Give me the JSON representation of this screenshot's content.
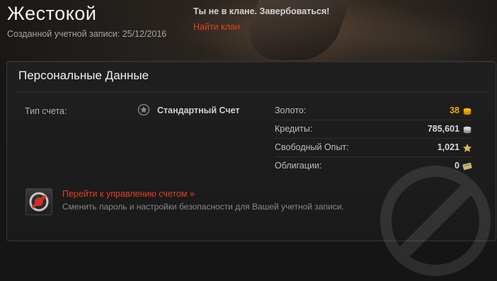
{
  "header": {
    "player_name": "Жестокой",
    "created_label": "Созданной учетной записи: 25/12/2016",
    "clan_status": "Ты не в клане. Завербоваться!",
    "find_clan": "Найти клан"
  },
  "panel": {
    "title": "Персональные Данные",
    "account_type_label": "Тип счета:",
    "account_type_value": "Стандартный Счет",
    "resources": [
      {
        "label": "Золото:",
        "value": "38",
        "icon": "gold-coins-icon"
      },
      {
        "label": "Кредиты:",
        "value": "785,601",
        "icon": "credits-icon"
      },
      {
        "label": "Свободный Опыт:",
        "value": "1,021",
        "icon": "free-xp-star-icon"
      },
      {
        "label": "Облигации:",
        "value": "0",
        "icon": "bonds-icon"
      }
    ],
    "manage_link": "Перейти к управлению счетом »",
    "manage_desc": "Сменить пароль и настройки безопасности для Вашей учетной записи."
  },
  "colors": {
    "accent_link": "#e3401f",
    "gold": "#f5a300"
  }
}
